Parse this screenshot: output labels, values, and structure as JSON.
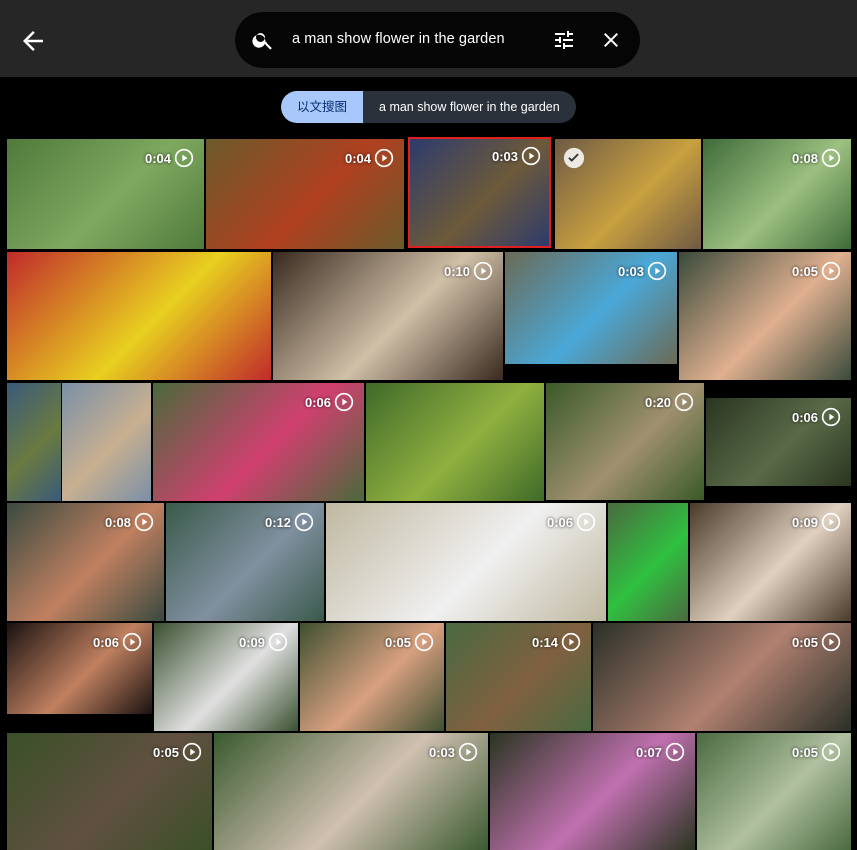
{
  "search": {
    "query": "a man show flower in the garden"
  },
  "chips": [
    {
      "label": "以文搜图"
    },
    {
      "label": "a man show flower in the garden"
    }
  ],
  "icons": {
    "back": "arrow-left-icon",
    "search": "search-icon",
    "filter": "tune-icon",
    "clear": "close-icon",
    "play": "play-circle-icon",
    "check": "check-circle-icon"
  },
  "colors": {
    "topbar": "#262626",
    "accent_chip": "#a8c7fa",
    "selection": "#e02020"
  },
  "results": [
    {
      "duration": "0:04"
    },
    {
      "duration": "0:04"
    },
    {
      "duration": "0:03",
      "selected": true
    },
    {
      "duration": "",
      "checked": true
    },
    {
      "duration": "0:08"
    },
    {
      "duration": ""
    },
    {
      "duration": "0:10"
    },
    {
      "duration": "0:03"
    },
    {
      "duration": "0:05"
    },
    {
      "duration": ""
    },
    {
      "duration": ""
    },
    {
      "duration": "0:06"
    },
    {
      "duration": ""
    },
    {
      "duration": "0:20"
    },
    {
      "duration": "0:06"
    },
    {
      "duration": "0:08"
    },
    {
      "duration": "0:12"
    },
    {
      "duration": "0:06"
    },
    {
      "duration": ""
    },
    {
      "duration": "0:09"
    },
    {
      "duration": "0:06"
    },
    {
      "duration": "0:09"
    },
    {
      "duration": "0:05"
    },
    {
      "duration": "0:14"
    },
    {
      "duration": "0:05"
    },
    {
      "duration": "0:05"
    },
    {
      "duration": "0:03"
    },
    {
      "duration": "0:07"
    },
    {
      "duration": "0:05"
    }
  ]
}
